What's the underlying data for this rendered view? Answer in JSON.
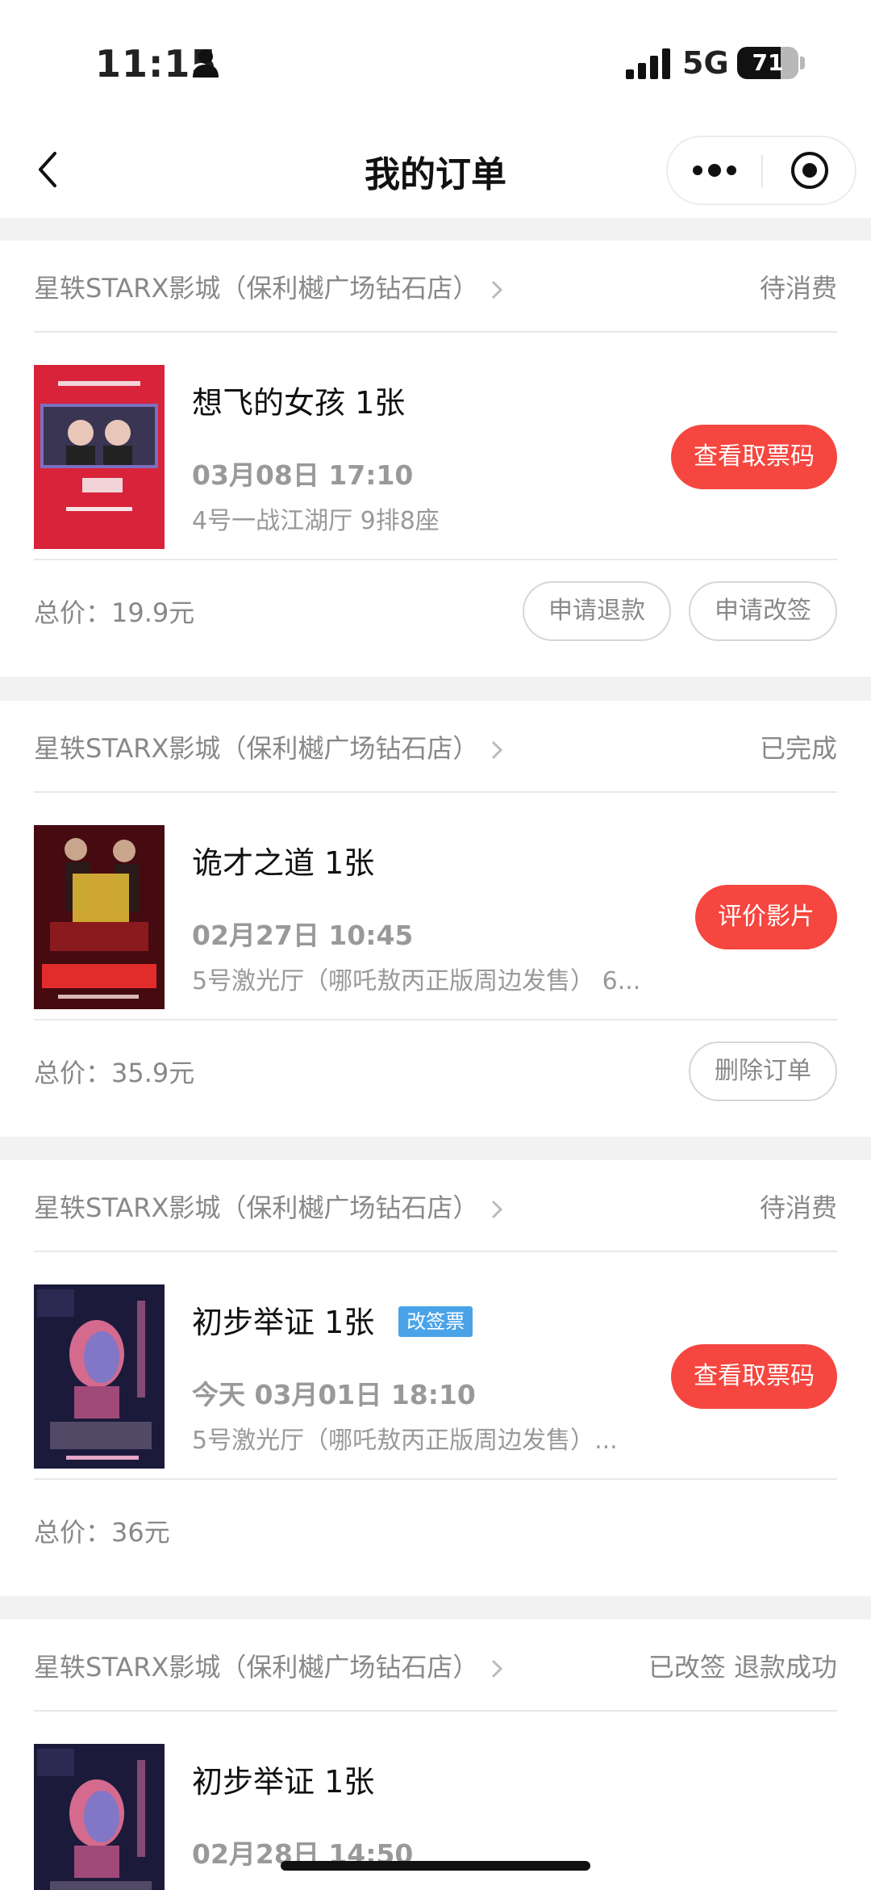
{
  "status_bar": {
    "time": "11:15",
    "network": "5G",
    "battery": "71",
    "battery_level": 0.71
  },
  "nav": {
    "title": "我的订单"
  },
  "orders": [
    {
      "store": "星轶STARX影城（保利樾广场钻石店）",
      "status": "待消费",
      "movie_title": "想飞的女孩 1张",
      "badge": "",
      "time": "03月08日 17:10",
      "hall": "4号一战江湖厅 9排8座",
      "action": "查看取票码",
      "total": "总价：19.9元",
      "buttons": [
        "申请退款",
        "申请改签"
      ]
    },
    {
      "store": "星轶STARX影城（保利樾广场钻石店）",
      "status": "已完成",
      "movie_title": "诡才之道 1张",
      "badge": "",
      "time": "02月27日 10:45",
      "hall": "5号激光厅（哪吒敖丙正版周边发售） 6...",
      "action": "评价影片",
      "total": "总价：35.9元",
      "buttons": [
        "删除订单"
      ]
    },
    {
      "store": "星轶STARX影城（保利樾广场钻石店）",
      "status": "待消费",
      "movie_title": "初步举证 1张",
      "badge": "改签票",
      "time": "今天 03月01日 18:10",
      "hall": "5号激光厅（哪吒敖丙正版周边发售）...",
      "action": "查看取票码",
      "total": "总价：36元",
      "buttons": []
    },
    {
      "store": "星轶STARX影城（保利樾广场钻石店）",
      "status": "已改签 退款成功",
      "movie_title": "初步举证 1张",
      "badge": "",
      "time": "02月28日 14:50",
      "hall": "",
      "action": "",
      "total": "",
      "buttons": []
    }
  ]
}
